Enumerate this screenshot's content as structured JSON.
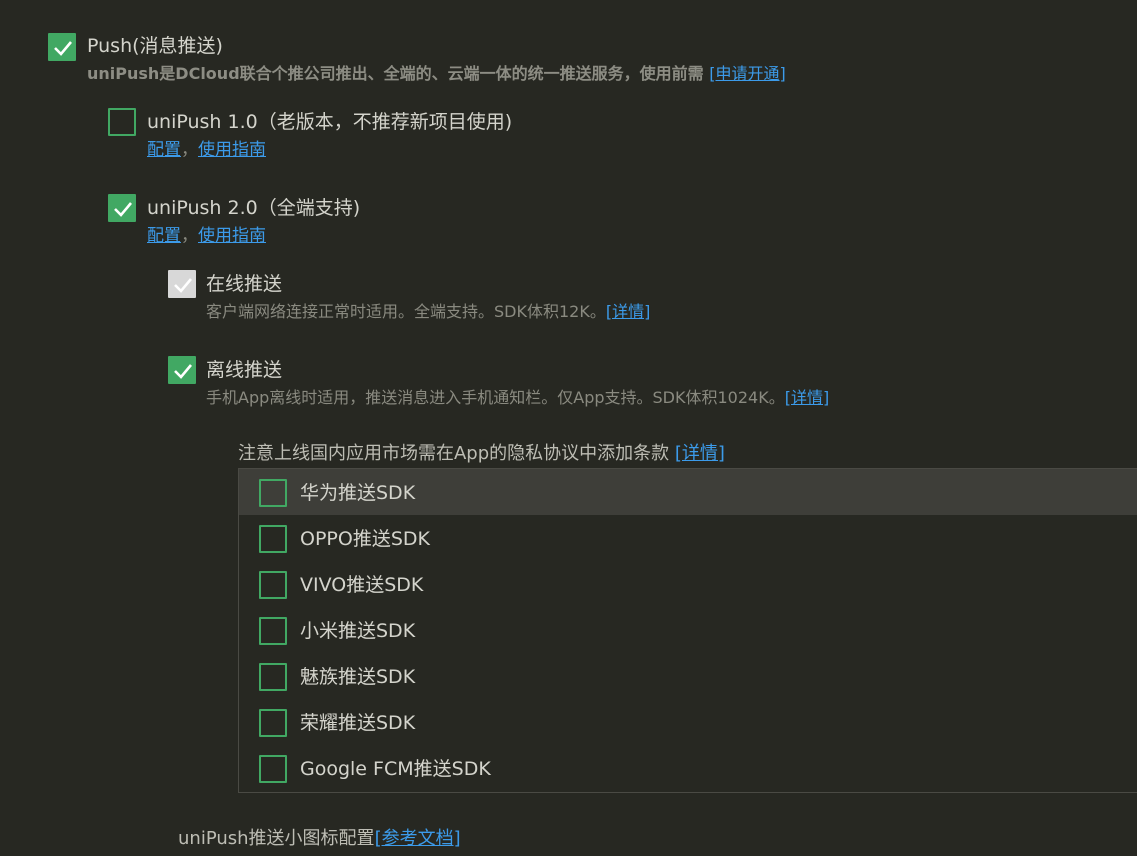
{
  "push": {
    "label": "Push(消息推送)",
    "desc_prefix": "uniPush是DCloud联合个推公司推出、全端的、云端一体的统一推送服务，使用前需 ",
    "apply_link": "[申请开通]"
  },
  "unipush1": {
    "label": "uniPush 1.0（老版本，不推荐新项目使用)",
    "config_link": "配置",
    "separator": "，",
    "guide_link": "使用指南"
  },
  "unipush2": {
    "label": "uniPush 2.0（全端支持)",
    "config_link": "配置",
    "separator": "，",
    "guide_link": "使用指南"
  },
  "online_push": {
    "label": "在线推送",
    "desc": "客户端网络连接正常时适用。全端支持。SDK体积12K。",
    "detail_link": "[详情]"
  },
  "offline_push": {
    "label": "离线推送",
    "desc": "手机App离线时适用，推送消息进入手机通知栏。仅App支持。SDK体积1024K。",
    "detail_link": "[详情]"
  },
  "privacy_note": {
    "text": "注意上线国内应用市场需在App的隐私协议中添加条款 ",
    "detail_link": "[详情]"
  },
  "sdk_list": [
    {
      "label": "华为推送SDK"
    },
    {
      "label": "OPPO推送SDK"
    },
    {
      "label": "VIVO推送SDK"
    },
    {
      "label": "小米推送SDK"
    },
    {
      "label": "魅族推送SDK"
    },
    {
      "label": "荣耀推送SDK"
    },
    {
      "label": "Google FCM推送SDK"
    }
  ],
  "icon_config": {
    "text": "uniPush推送小图标配置",
    "doc_link": "[参考文档]"
  },
  "colors": {
    "background": "#272822",
    "accent_green": "#41a863",
    "link_blue": "#3c9bea"
  }
}
